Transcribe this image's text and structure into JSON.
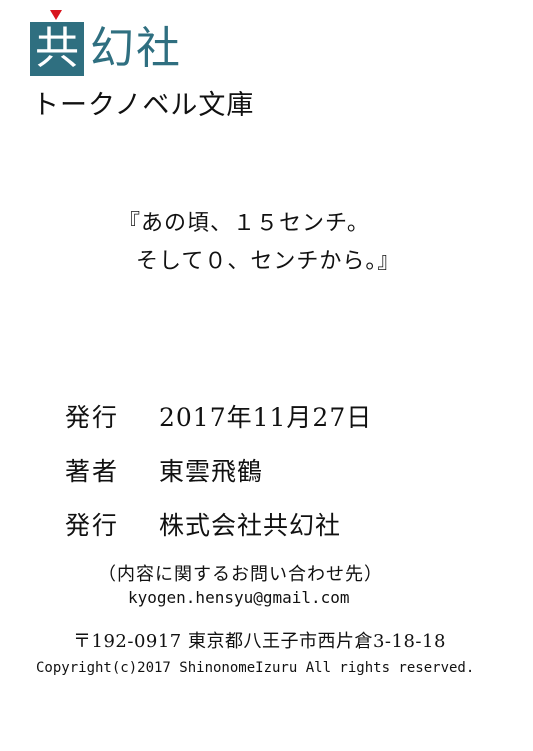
{
  "logo": {
    "box_char": "共",
    "rest_text": "幻社",
    "brand_color": "#2f6f80",
    "marker_color": "#d8141d"
  },
  "label": "トークノベル文庫",
  "title": {
    "line1": "『あの頃、１５センチ。",
    "line2": "そして０、センチから。』"
  },
  "colophon": [
    {
      "key": "発行",
      "value": "2017年11月27日"
    },
    {
      "key": "著者",
      "value": "東雲飛鶴"
    },
    {
      "key": "発行",
      "value": "株式会社共幻社"
    }
  ],
  "contact": {
    "label": "（内容に関するお問い合わせ先）",
    "email": "kyogen.hensyu@gmail.com"
  },
  "address": "〒192-0917 東京都八王子市西片倉3-18-18",
  "copyright": "Copyright(c)2017 ShinonomeIzuru All rights reserved."
}
